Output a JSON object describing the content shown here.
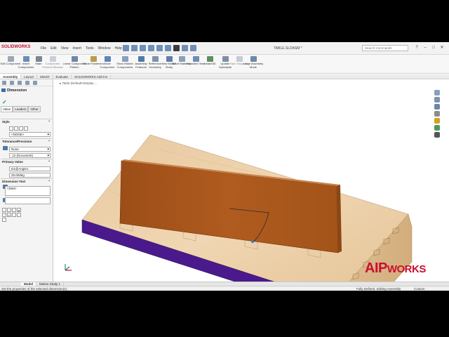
{
  "app": {
    "logo": "SOLIDWORKS",
    "document_title": "TABLE.SLDASM *",
    "search_placeholder": "Search Commands"
  },
  "menu": [
    "File",
    "Edit",
    "View",
    "Insert",
    "Tools",
    "Window",
    "Help"
  ],
  "commands": [
    {
      "label": "Edit Component"
    },
    {
      "label": "Insert Components"
    },
    {
      "label": "Mate"
    },
    {
      "label": "Component Preview Window"
    },
    {
      "label": "Linear Component Pattern"
    },
    {
      "label": "Smart Fasteners"
    },
    {
      "label": "Move Component"
    },
    {
      "label": "Show Hidden Components"
    },
    {
      "label": "Assembly Features"
    },
    {
      "label": "Reference Geometry"
    },
    {
      "label": "New Motion Study"
    },
    {
      "label": "Bill of Materials"
    },
    {
      "label": "Exploded View"
    },
    {
      "label": "Instant3D"
    },
    {
      "label": "Update Speedpak"
    },
    {
      "label": "Take Snapshot"
    },
    {
      "label": "Large Assembly Mode"
    }
  ],
  "tabs": [
    "Assembly",
    "Layout",
    "Sketch",
    "Evaluate",
    "SOLIDWORKS Add-Ins"
  ],
  "property_manager": {
    "title": "Dimension",
    "subtabs": [
      "Value",
      "Leaders",
      "Other"
    ],
    "style_label": "Style",
    "style_value": "<NONE>",
    "tolerance_label": "Tolerance/Precision",
    "tolerance_value": "None",
    "precision_value": ".12 (Document)",
    "primary_label": "Primary Value",
    "primary_name": "D1@Angle1",
    "primary_value": "25.00deg",
    "dimtext_label": "Dimension Text",
    "dimtext_value": "<DIM>"
  },
  "viewport": {
    "breadcrumb": "Table (Default<Display ..."
  },
  "brand": {
    "part1": "AIP",
    "part2": "WORKS"
  },
  "bottom_tabs": [
    "Model",
    "Motion Study 1"
  ],
  "status": {
    "message": "Set the properties of the selected dimension(s).",
    "state": "Fully Defined",
    "mode": "Editing Assembly",
    "units": "Custom"
  }
}
